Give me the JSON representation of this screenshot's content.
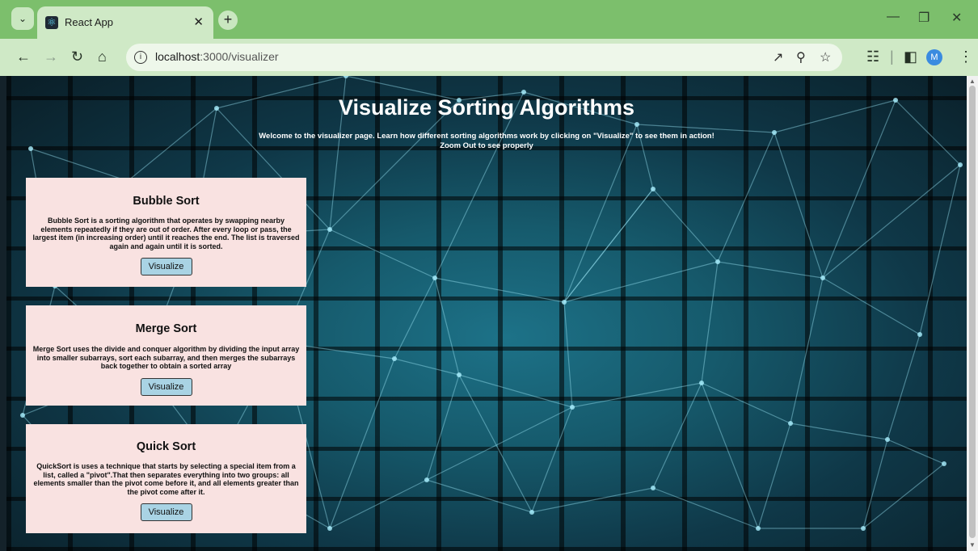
{
  "browser": {
    "tab_title": "React App",
    "url_host": "localhost",
    "url_path": ":3000/visualizer",
    "avatar_initial": "M"
  },
  "page": {
    "title": "Visualize Sorting Algorithms",
    "intro_line1": "Welcome to the visualizer page. Learn how different sorting algorithms work by clicking on \"Visualize\" to see them in action!",
    "intro_line2": "Zoom Out to see properly"
  },
  "cards": [
    {
      "title": "Bubble Sort",
      "description": "Bubble Sort is a sorting algorithm that operates by swapping nearby elements repeatedly if they are out of order. After every loop or pass, the largest item (in increasing order) until it reaches the end. The list is traversed again and again until it is sorted.",
      "button": "Visualize"
    },
    {
      "title": "Merge Sort",
      "description": "Merge Sort uses the divide and conquer algorithm by dividing the input array into smaller subarrays, sort each subarray, and then merges the subarrays back together to obtain a sorted array",
      "button": "Visualize"
    },
    {
      "title": "Quick Sort",
      "description": "QuickSort is uses a technique that starts by selecting a special item from a list, called a \"pivot\".That then separates everything into two groups: all elements smaller than the pivot come before it, and all elements greater than the pivot come after it.",
      "button": "Visualize"
    }
  ]
}
